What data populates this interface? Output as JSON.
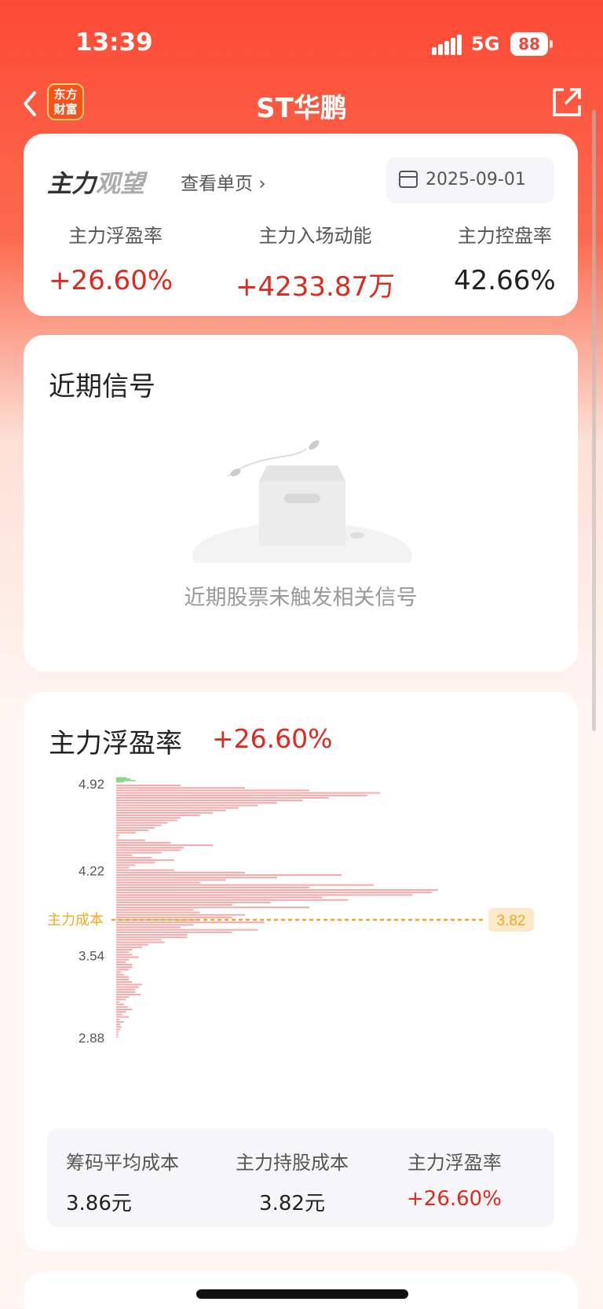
{
  "status": {
    "time": "13:39",
    "network": "5G",
    "battery": "88"
  },
  "nav": {
    "title": "ST华鹏",
    "logo_line1": "东方",
    "logo_line2": "财富"
  },
  "summary_card": {
    "brand_strong": "主力",
    "brand_weak": "观望",
    "link": "查看单页",
    "date": "2025-09-01",
    "metrics": [
      {
        "label": "主力浮盈率",
        "value": "+26.60%"
      },
      {
        "label": "主力入场动能",
        "value": "+4233.87万"
      },
      {
        "label": "主力控盘率",
        "value": "42.66%"
      }
    ]
  },
  "signal_card": {
    "title": "近期信号",
    "empty_message": "近期股票未触发相关信号"
  },
  "profit_card": {
    "title": "主力浮盈率",
    "value": "+26.60%",
    "summary": [
      {
        "label": "筹码平均成本",
        "value": "3.86元"
      },
      {
        "label": "主力持股成本",
        "value": "3.82元"
      },
      {
        "label": "主力浮盈率",
        "value": "+26.60%"
      }
    ]
  },
  "chart_data": {
    "type": "bar",
    "orientation": "horizontal",
    "y_tick_labels": [
      "4.92",
      "4.22",
      "3.54",
      "2.88"
    ],
    "ylim": [
      2.86,
      4.97
    ],
    "cost_line": {
      "label": "主力成本",
      "value": 3.82,
      "value_label": "3.82"
    },
    "colors": {
      "profit": "#f7a8a8",
      "loss": "#8fd68f",
      "cost": "#f5a623"
    },
    "prices": [
      4.96,
      4.95,
      4.94,
      4.93,
      4.9,
      4.88,
      4.86,
      4.84,
      4.82,
      4.8,
      4.78,
      4.76,
      4.74,
      4.72,
      4.7,
      4.68,
      4.66,
      4.64,
      4.62,
      4.6,
      4.58,
      4.56,
      4.54,
      4.52,
      4.5,
      4.48,
      4.46,
      4.44,
      4.42,
      4.4,
      4.38,
      4.36,
      4.34,
      4.32,
      4.3,
      4.28,
      4.26,
      4.24,
      4.22,
      4.2,
      4.18,
      4.16,
      4.14,
      4.12,
      4.1,
      4.08,
      4.06,
      4.04,
      4.02,
      4.0,
      3.98,
      3.96,
      3.94,
      3.92,
      3.9,
      3.88,
      3.86,
      3.84,
      3.82,
      3.8,
      3.78,
      3.76,
      3.74,
      3.72,
      3.7,
      3.68,
      3.66,
      3.64,
      3.62,
      3.6,
      3.58,
      3.56,
      3.54,
      3.52,
      3.5,
      3.48,
      3.46,
      3.44,
      3.42,
      3.4,
      3.38,
      3.36,
      3.34,
      3.32,
      3.3,
      3.28,
      3.26,
      3.24,
      3.22,
      3.2,
      3.18,
      3.16,
      3.14,
      3.12,
      3.1,
      3.08,
      3.06,
      3.04,
      3.02,
      3.0,
      2.98,
      2.96,
      2.94,
      2.92,
      2.9,
      2.88
    ],
    "values": [
      16,
      22,
      30,
      12,
      100,
      200,
      300,
      410,
      390,
      330,
      290,
      250,
      220,
      190,
      170,
      150,
      130,
      100,
      95,
      80,
      70,
      60,
      50,
      30,
      5,
      3,
      45,
      85,
      150,
      105,
      100,
      70,
      25,
      55,
      90,
      60,
      30,
      20,
      90,
      200,
      350,
      250,
      170,
      130,
      400,
      300,
      500,
      490,
      460,
      320,
      360,
      240,
      180,
      300,
      120,
      130,
      200,
      180,
      130,
      230,
      120,
      100,
      220,
      180,
      110,
      110,
      70,
      75,
      50,
      40,
      25,
      20,
      25,
      35,
      20,
      15,
      25,
      25,
      20,
      8,
      12,
      20,
      20,
      25,
      40,
      35,
      30,
      30,
      38,
      20,
      15,
      5,
      12,
      18,
      25,
      15,
      10,
      20,
      5,
      12,
      6,
      8,
      6,
      4,
      3,
      2
    ]
  }
}
